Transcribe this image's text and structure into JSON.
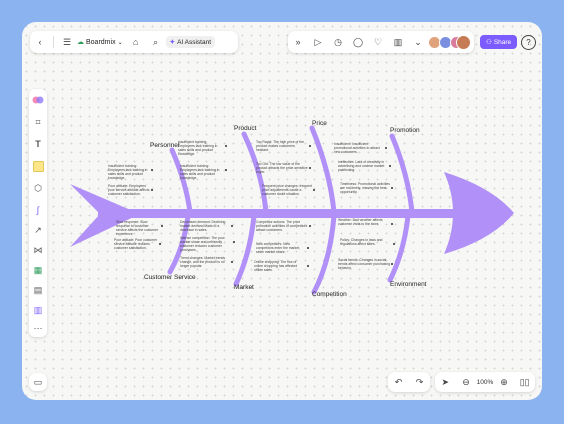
{
  "app": {
    "brand": "Boardmix",
    "ai_label": "AI Assistant",
    "share_label": "Share",
    "help": "?",
    "zoom": "100%",
    "more": "···"
  },
  "colors": {
    "accent": "#7c5cff",
    "fish": "#b190f7",
    "background": "#8ab3ef"
  },
  "diagram": {
    "categories": {
      "personnel": "Personnel",
      "product": "Product",
      "price": "Price",
      "promotion": "Promotion",
      "customer_service": "Customer Service",
      "market": "Market",
      "competition": "Competition",
      "environment": "Environment"
    },
    "notes": {
      "p1": "Insufficient training: Employees lack training in sales skills and product knowledge.",
      "p2": "Insufficient training: Employees lack training in sales skills and product knowledge.",
      "p3": "Poor attitude: Employees' poor service attitude affects customer satisfaction.",
      "p4": "Insufficient training: Employees lack training in sales skills and product knowledge.",
      "pr1": "Too Rapid: The high price of the product makes customers hesitant.",
      "pr2": "Too Old: The low value of the product attracts the price-sensitive buyer.",
      "pr3": "Frequent price changes: frequent price adjustments cause a customer doubt situation.",
      "pm1": "Insufficient: Insufficient promotional activities to attract new customers.",
      "pm2": "Ineffective: Lack of creativity in advertising and unclear market positioning.",
      "pm3": "Timeliness: Promotional activities are not timely, missing the best opportunity.",
      "cs1": "Slow response: Slow response to customer service affects the customer experience.",
      "cs2": "Poor attitude: Poor customer service attitude reduces customer satisfaction.",
      "m1": "Decreased demand: Declining market demand leads to a decrease in sales.",
      "m2": "Intense competition: The poor market share and unfriendly customer reduces customer purchases.",
      "m3": "Trend changes: Market trends change, and the product is no longer popular.",
      "c1": "Competitor actions: The price promotion activities of competitors attract customers.",
      "c2": "New competitors: New competitors enter the market, seize market share.",
      "c3": "Online shopping: The rise of online shopping has affected offline sales.",
      "e1": "Weather: Bad weather affects customer visits to the store.",
      "e2": "Policy: Changes in laws and regulations affect sales.",
      "e3": "Social trends: Changes in social trends affect consumer purchasing behavior."
    }
  }
}
